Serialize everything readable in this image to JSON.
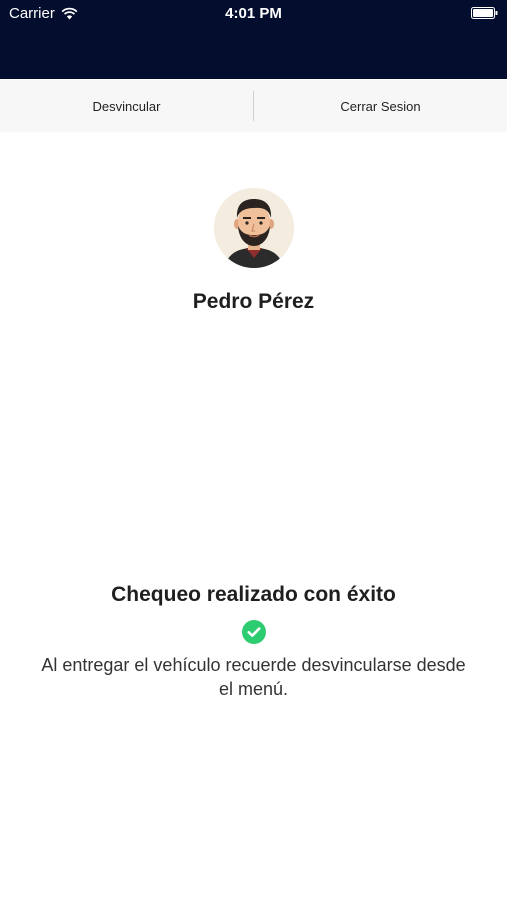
{
  "status_bar": {
    "carrier": "Carrier",
    "time": "4:01 PM",
    "wifi_icon": "wifi-icon",
    "battery_icon": "battery-icon"
  },
  "segments": {
    "unlink_label": "Desvincular",
    "logout_label": "Cerrar Sesion"
  },
  "profile": {
    "avatar_icon": "avatar-icon",
    "name": "Pedro Pérez"
  },
  "status": {
    "title": "Chequeo realizado con éxito",
    "check_icon": "check-circle-icon",
    "message": "Al entregar el vehículo recuerde desvincularse desde el menú.",
    "accent_color": "#2ecc71"
  },
  "colors": {
    "header_bg": "#030e2e",
    "segment_bg": "#f7f7f7"
  }
}
